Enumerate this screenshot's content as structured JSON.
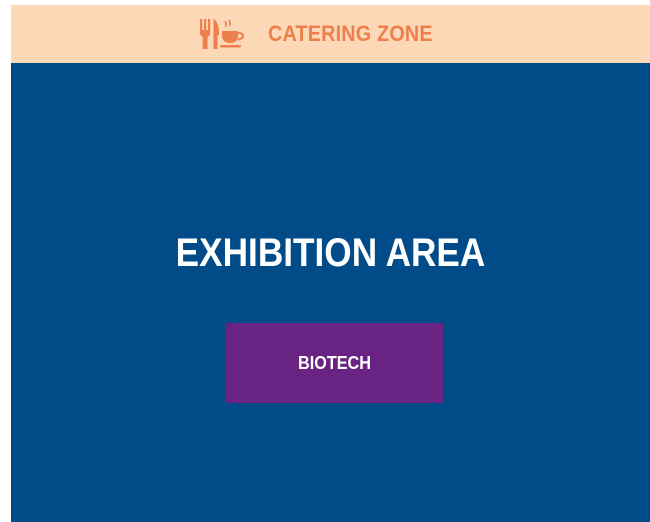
{
  "catering_zone": {
    "label": "CATERING ZONE",
    "icons": [
      "fork-knife-icon",
      "coffee-cup-icon"
    ],
    "background_color": "#fdd8b7",
    "text_color": "#ed7f4c"
  },
  "exhibition_area": {
    "label": "EXHIBITION AREA",
    "background_color": "#024b89",
    "booths": [
      {
        "label": "BIOTECH",
        "color": "#692383"
      }
    ]
  }
}
